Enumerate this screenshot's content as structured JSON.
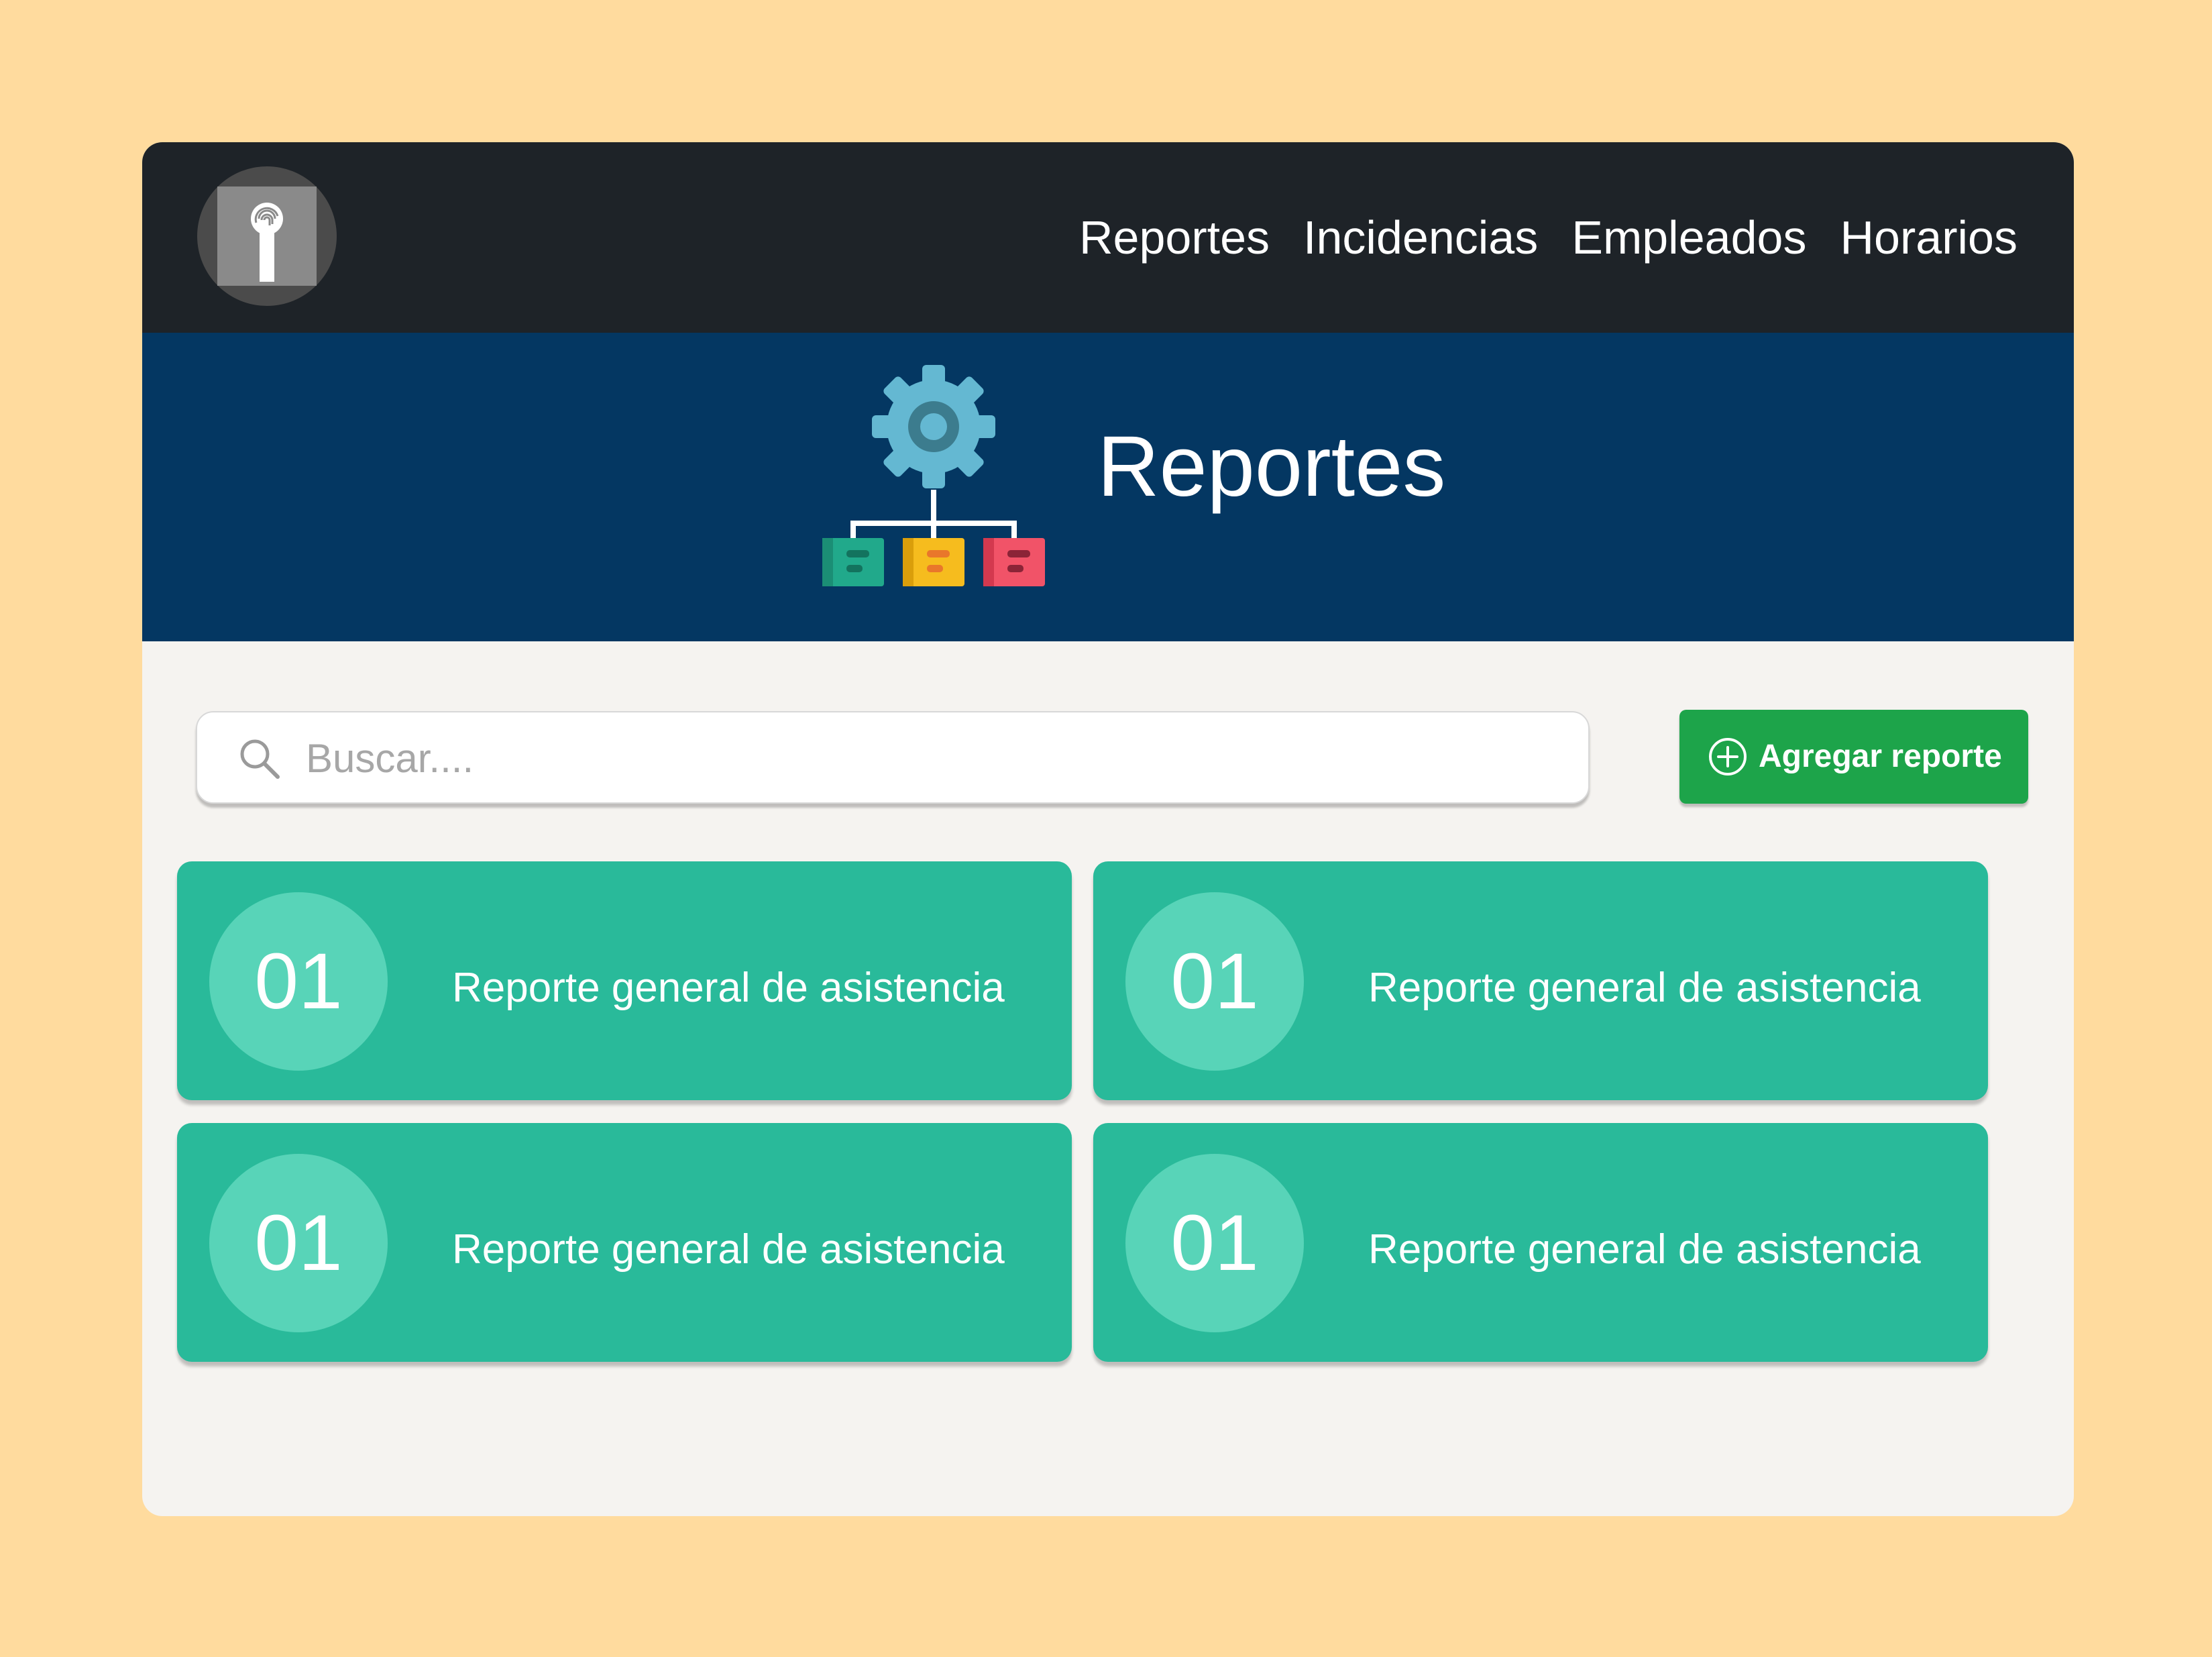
{
  "navbar": {
    "logo_icon": "fingerprint-key-icon",
    "items": [
      {
        "label": "Reportes"
      },
      {
        "label": "Incidencias"
      },
      {
        "label": "Empleados"
      },
      {
        "label": "Horarios"
      }
    ]
  },
  "hero": {
    "icon": "gear-hierarchy-icon",
    "title": "Reportes"
  },
  "search": {
    "icon": "search-icon",
    "placeholder": "Buscar....",
    "value": ""
  },
  "add_button": {
    "icon": "plus-circle-icon",
    "label": "Agregar reporte"
  },
  "reports": [
    {
      "number": "01",
      "title": "Reporte general de asistencia"
    },
    {
      "number": "01",
      "title": "Reporte general de asistencia"
    },
    {
      "number": "01",
      "title": "Reporte general de asistencia"
    },
    {
      "number": "01",
      "title": "Reporte general de asistencia"
    }
  ],
  "colors": {
    "page_background": "#FFDB9E",
    "navbar": "#1E2328",
    "hero": "#043762",
    "content_background": "#F5F3F0",
    "card": "#29BA9A",
    "card_badge": "#58D4B8",
    "add_button": "#1DA44A"
  }
}
